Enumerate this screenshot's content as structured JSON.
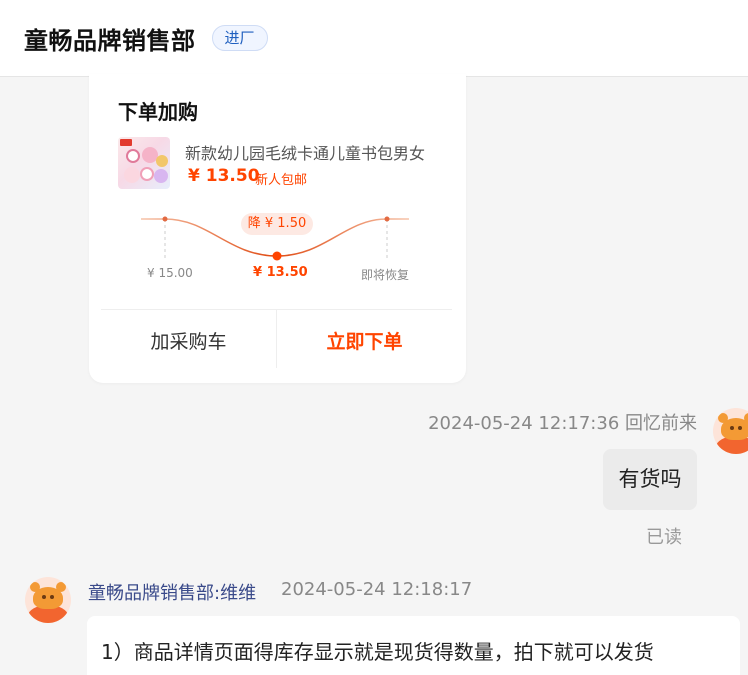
{
  "header": {
    "title": "童畅品牌销售部",
    "badge": "进厂"
  },
  "order_card": {
    "title": "下单加购",
    "product_name": "新款幼儿园毛绒卡通儿童书包男女",
    "price": "¥ 13.50",
    "promo": "新人包邮",
    "price_drop_badge": "降 ¥ 1.50",
    "original_price_label": "¥ 15.00",
    "current_price_label": "¥ 13.50",
    "restore_label": "即将恢复",
    "add_to_cart_label": "加采购车",
    "order_now_label": "立即下单",
    "accent_color": "#ff4400"
  },
  "messages": {
    "me": {
      "meta": "2024-05-24 12:17:36  回忆前来",
      "text": "有货吗",
      "status": "已读"
    },
    "shop": {
      "sender": "童畅品牌销售部:维维",
      "time": "2024-05-24 12:18:17",
      "text": "1）商品详情页面得库存显示就是现货得数量，拍下就可以发货"
    }
  },
  "icons": {
    "avatar": "cartoon-bull-avatar",
    "product_thumbnail": "plush-backpack-thumbnail"
  }
}
